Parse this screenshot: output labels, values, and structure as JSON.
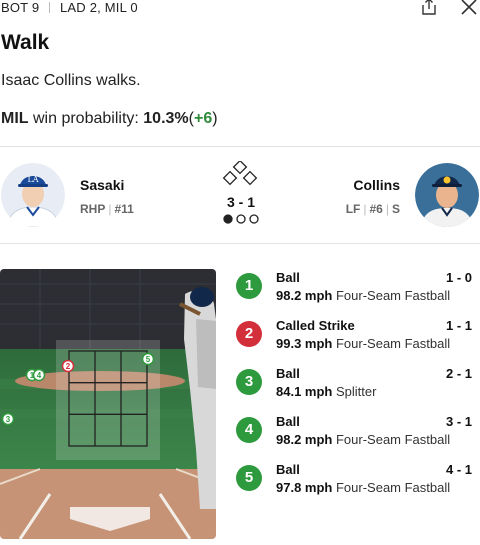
{
  "header": {
    "inning": "BOT 9",
    "score": "LAD 2, MIL 0",
    "share_icon": "share-icon",
    "close_icon": "close-icon"
  },
  "play": {
    "title": "Walk",
    "description": "Isaac Collins walks."
  },
  "win_probability": {
    "team": "MIL",
    "label": "win probability:",
    "value": "10.3%",
    "change_open": "(",
    "change": "+6",
    "change_close": ")"
  },
  "matchup": {
    "pitcher": {
      "name": "Sasaki",
      "position": "RHP",
      "number": "#11",
      "team_color": "#1c4a9a"
    },
    "batter": {
      "name": "Collins",
      "position": "LF",
      "number": "#6",
      "bats": "S",
      "team_color": "#12284b"
    },
    "count": "3 - 1",
    "outs": 1,
    "outs_max": 3,
    "runners_on": []
  },
  "strike_zone": {
    "markers": [
      {
        "label": "2",
        "result": "Called Strike"
      },
      {
        "label": "5",
        "result": "Ball"
      },
      {
        "label": "1",
        "result": "Ball"
      },
      {
        "label": "4",
        "result": "Ball"
      },
      {
        "label": "3",
        "result": "Ball"
      }
    ]
  },
  "colors": {
    "ball": "#2e9a3e",
    "strike": "#d32f3a",
    "delta_positive": "#2e8b3a"
  },
  "pitches": [
    {
      "number": "1",
      "result": "Ball",
      "count": "1 - 0",
      "speed": "98.2 mph",
      "type": "Four-Seam Fastball",
      "kind": "ball"
    },
    {
      "number": "2",
      "result": "Called Strike",
      "count": "1 - 1",
      "speed": "99.3 mph",
      "type": "Four-Seam Fastball",
      "kind": "strike"
    },
    {
      "number": "3",
      "result": "Ball",
      "count": "2 - 1",
      "speed": "84.1 mph",
      "type": "Splitter",
      "kind": "ball"
    },
    {
      "number": "4",
      "result": "Ball",
      "count": "3 - 1",
      "speed": "98.2 mph",
      "type": "Four-Seam Fastball",
      "kind": "ball"
    },
    {
      "number": "5",
      "result": "Ball",
      "count": "4 - 1",
      "speed": "97.8 mph",
      "type": "Four-Seam Fastball",
      "kind": "ball"
    }
  ]
}
